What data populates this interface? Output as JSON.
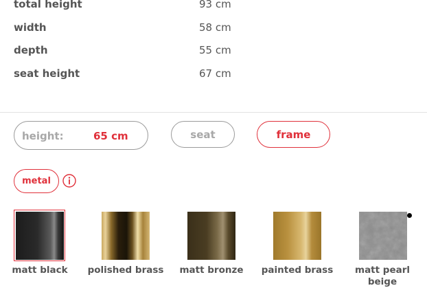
{
  "dimensions": [
    {
      "label": "total height",
      "value": "93 cm"
    },
    {
      "label": "width",
      "value": "58 cm"
    },
    {
      "label": "depth",
      "value": "55 cm"
    },
    {
      "label": "seat height",
      "value": "67 cm"
    }
  ],
  "height_selector": {
    "label": "height:",
    "value": "65 cm"
  },
  "tabs": {
    "seat": "seat",
    "frame": "frame",
    "selected": "frame"
  },
  "material": {
    "label": "metal",
    "info_icon": "info-icon"
  },
  "finishes": [
    {
      "name": "matt black",
      "selected": true
    },
    {
      "name": "polished brass",
      "selected": false
    },
    {
      "name": "matt bronze",
      "selected": false
    },
    {
      "name": "painted brass",
      "selected": false
    },
    {
      "name": "matt pearl beige",
      "selected": false
    }
  ],
  "colors": {
    "accent": "#e0303a",
    "text": "#555555",
    "muted": "#a8a8a8",
    "border": "#9a9a9a"
  }
}
